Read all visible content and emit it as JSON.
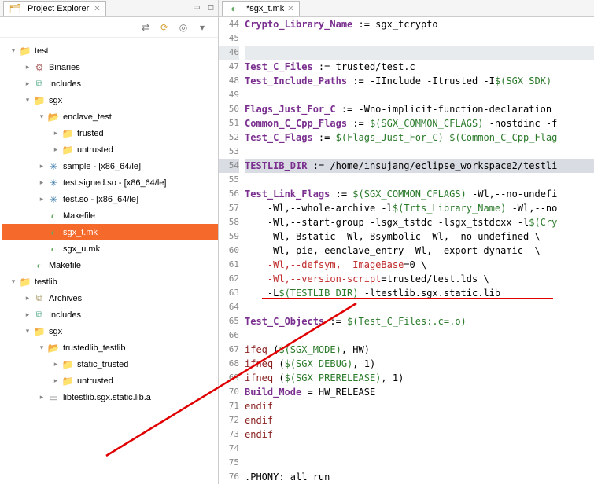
{
  "left": {
    "tab_title": "Project Explorer",
    "tree": [
      {
        "d": 0,
        "tw": "▾",
        "icon": "folder-open",
        "cls": "c-icon",
        "glyph": "📁",
        "label": "test"
      },
      {
        "d": 1,
        "tw": "▸",
        "icon": "bin-icon",
        "glyph": "⚙",
        "label": "Binaries"
      },
      {
        "d": 1,
        "tw": "▸",
        "icon": "inc-icon",
        "glyph": "⧉",
        "label": "Includes"
      },
      {
        "d": 1,
        "tw": "▾",
        "icon": "folder-icon",
        "glyph": "📁",
        "label": "sgx"
      },
      {
        "d": 2,
        "tw": "▾",
        "icon": "folder-open",
        "glyph": "📂",
        "label": "enclave_test"
      },
      {
        "d": 3,
        "tw": "▸",
        "icon": "folder-icon",
        "glyph": "📁",
        "label": "trusted"
      },
      {
        "d": 3,
        "tw": "▸",
        "icon": "folder-icon",
        "glyph": "📁",
        "label": "untrusted"
      },
      {
        "d": 2,
        "tw": "▸",
        "icon": "bug-icon",
        "glyph": "✳",
        "label": "sample - [x86_64/le]"
      },
      {
        "d": 2,
        "tw": "▸",
        "icon": "bug-icon",
        "glyph": "✳",
        "label": "test.signed.so - [x86_64/le]"
      },
      {
        "d": 2,
        "tw": "▸",
        "icon": "bug-icon",
        "glyph": "✳",
        "label": "test.so - [x86_64/le]"
      },
      {
        "d": 2,
        "tw": "",
        "icon": "mk-icon",
        "glyph": "◐",
        "label": "Makefile"
      },
      {
        "d": 2,
        "tw": "",
        "icon": "mk-icon",
        "glyph": "◐",
        "label": "sgx_t.mk",
        "selected": true
      },
      {
        "d": 2,
        "tw": "",
        "icon": "mk-icon",
        "glyph": "◐",
        "label": "sgx_u.mk"
      },
      {
        "d": 1,
        "tw": "",
        "icon": "mk-icon",
        "glyph": "◐",
        "label": "Makefile"
      },
      {
        "d": 0,
        "tw": "▾",
        "icon": "folder-open",
        "glyph": "📁",
        "label": "testlib"
      },
      {
        "d": 1,
        "tw": "▸",
        "icon": "arc-icon",
        "glyph": "⧉",
        "label": "Archives"
      },
      {
        "d": 1,
        "tw": "▸",
        "icon": "inc-icon",
        "glyph": "⧉",
        "label": "Includes"
      },
      {
        "d": 1,
        "tw": "▾",
        "icon": "folder-icon",
        "glyph": "📁",
        "label": "sgx"
      },
      {
        "d": 2,
        "tw": "▾",
        "icon": "folder-open",
        "glyph": "📂",
        "label": "trustedlib_testlib"
      },
      {
        "d": 3,
        "tw": "▸",
        "icon": "folder-icon",
        "glyph": "📁",
        "label": "static_trusted"
      },
      {
        "d": 3,
        "tw": "▸",
        "icon": "folder-icon",
        "glyph": "📁",
        "label": "untrusted"
      },
      {
        "d": 2,
        "tw": "▸",
        "icon": "lib-icon",
        "glyph": "▭",
        "label": "libtestlib.sgx.static.lib.a"
      }
    ]
  },
  "editor": {
    "tab_title": "*sgx_t.mk",
    "first_line": 44,
    "lines": [
      {
        "n": 44,
        "segs": [
          {
            "t": "Crypto_Library_Name",
            "c": "kw"
          },
          {
            "t": " := sgx_tcrypto",
            "c": ""
          }
        ]
      },
      {
        "n": 45,
        "segs": []
      },
      {
        "n": 46,
        "hl": "line",
        "segs": []
      },
      {
        "n": 47,
        "segs": [
          {
            "t": "Test_C_Files",
            "c": "kw"
          },
          {
            "t": " := trusted/test.c",
            "c": ""
          }
        ]
      },
      {
        "n": 48,
        "segs": [
          {
            "t": "Test_Include_Paths",
            "c": "kw"
          },
          {
            "t": " := -IInclude -Itrusted -I",
            "c": ""
          },
          {
            "t": "$(SGX_SDK)",
            "c": "var"
          }
        ]
      },
      {
        "n": 49,
        "segs": []
      },
      {
        "n": 50,
        "segs": [
          {
            "t": "Flags_Just_For_C",
            "c": "kw"
          },
          {
            "t": " := -Wno-implicit-function-declaration ",
            "c": ""
          }
        ]
      },
      {
        "n": 51,
        "segs": [
          {
            "t": "Common_C_Cpp_Flags",
            "c": "kw"
          },
          {
            "t": " := ",
            "c": ""
          },
          {
            "t": "$(SGX_COMMON_CFLAGS)",
            "c": "var"
          },
          {
            "t": " -nostdinc -f",
            "c": ""
          }
        ]
      },
      {
        "n": 52,
        "segs": [
          {
            "t": "Test_C_Flags",
            "c": "kw"
          },
          {
            "t": " := ",
            "c": ""
          },
          {
            "t": "$(Flags_Just_For_C)",
            "c": "var"
          },
          {
            "t": " ",
            "c": ""
          },
          {
            "t": "$(Common_C_Cpp_Flag",
            "c": "var"
          }
        ]
      },
      {
        "n": 53,
        "segs": []
      },
      {
        "n": 54,
        "hl": "cursor",
        "segs": [
          {
            "t": "TESTLIB_DIR",
            "c": "kw"
          },
          {
            "t": " := /home/insujang/eclipse_workspace2/testli",
            "c": ""
          }
        ]
      },
      {
        "n": 55,
        "segs": []
      },
      {
        "n": 56,
        "segs": [
          {
            "t": "Test_Link_Flags",
            "c": "kw"
          },
          {
            "t": " := ",
            "c": ""
          },
          {
            "t": "$(SGX_COMMON_CFLAGS)",
            "c": "var"
          },
          {
            "t": " -Wl,--no-undefi",
            "c": ""
          }
        ]
      },
      {
        "n": 57,
        "segs": [
          {
            "t": "    -Wl,--whole-archive -l",
            "c": ""
          },
          {
            "t": "$(Trts_Library_Name)",
            "c": "var"
          },
          {
            "t": " -Wl,--no",
            "c": ""
          }
        ]
      },
      {
        "n": 58,
        "segs": [
          {
            "t": "    -Wl,--start-group -lsgx_tstdc -lsgx_tstdcxx -l",
            "c": ""
          },
          {
            "t": "$(Cry",
            "c": "var"
          }
        ]
      },
      {
        "n": 59,
        "segs": [
          {
            "t": "    -Wl,-Bstatic -Wl,-Bsymbolic -Wl,--no-undefined \\",
            "c": ""
          }
        ]
      },
      {
        "n": 60,
        "segs": [
          {
            "t": "    -Wl,-pie,-eenclave_entry -Wl,--export-dynamic  \\",
            "c": ""
          }
        ]
      },
      {
        "n": 61,
        "segs": [
          {
            "t": "    ",
            "c": ""
          },
          {
            "t": "-Wl,--defsym,__ImageBase",
            "c": "red"
          },
          {
            "t": "=0 \\",
            "c": ""
          }
        ]
      },
      {
        "n": 62,
        "segs": [
          {
            "t": "    ",
            "c": ""
          },
          {
            "t": "-Wl,--version-script",
            "c": "red"
          },
          {
            "t": "=trusted/test.lds \\",
            "c": ""
          }
        ]
      },
      {
        "n": 63,
        "segs": [
          {
            "t": "    -L",
            "c": ""
          },
          {
            "t": "$(TESTLIB_DIR)",
            "c": "var"
          },
          {
            "t": " -ltestlib.sgx.static.lib",
            "c": ""
          }
        ],
        "underline": true
      },
      {
        "n": 64,
        "segs": []
      },
      {
        "n": 65,
        "segs": [
          {
            "t": "Test_C_Objects",
            "c": "kw"
          },
          {
            "t": " := ",
            "c": ""
          },
          {
            "t": "$(Test_C_Files:.c=.o)",
            "c": "var"
          }
        ]
      },
      {
        "n": 66,
        "segs": []
      },
      {
        "n": 67,
        "segs": [
          {
            "t": "ifeq",
            "c": "dkred"
          },
          {
            "t": " (",
            "c": ""
          },
          {
            "t": "$(SGX_MODE)",
            "c": "var"
          },
          {
            "t": ", HW)",
            "c": ""
          }
        ]
      },
      {
        "n": 68,
        "segs": [
          {
            "t": "ifneq",
            "c": "dkred"
          },
          {
            "t": " (",
            "c": ""
          },
          {
            "t": "$(SGX_DEBUG)",
            "c": "var"
          },
          {
            "t": ", 1)",
            "c": ""
          }
        ]
      },
      {
        "n": 69,
        "segs": [
          {
            "t": "ifneq",
            "c": "dkred"
          },
          {
            "t": " (",
            "c": ""
          },
          {
            "t": "$(SGX_PRERELEASE)",
            "c": "var"
          },
          {
            "t": ", 1)",
            "c": ""
          }
        ]
      },
      {
        "n": 70,
        "segs": [
          {
            "t": "Build_Mode",
            "c": "kw"
          },
          {
            "t": " = HW_RELEASE",
            "c": ""
          }
        ]
      },
      {
        "n": 71,
        "segs": [
          {
            "t": "endif",
            "c": "dkred"
          }
        ]
      },
      {
        "n": 72,
        "segs": [
          {
            "t": "endif",
            "c": "dkred"
          }
        ]
      },
      {
        "n": 73,
        "segs": [
          {
            "t": "endif",
            "c": "dkred"
          }
        ]
      },
      {
        "n": 74,
        "segs": []
      },
      {
        "n": 75,
        "segs": []
      },
      {
        "n": 76,
        "segs": [
          {
            "t": ".PHONY: all run",
            "c": ""
          }
        ]
      }
    ]
  }
}
